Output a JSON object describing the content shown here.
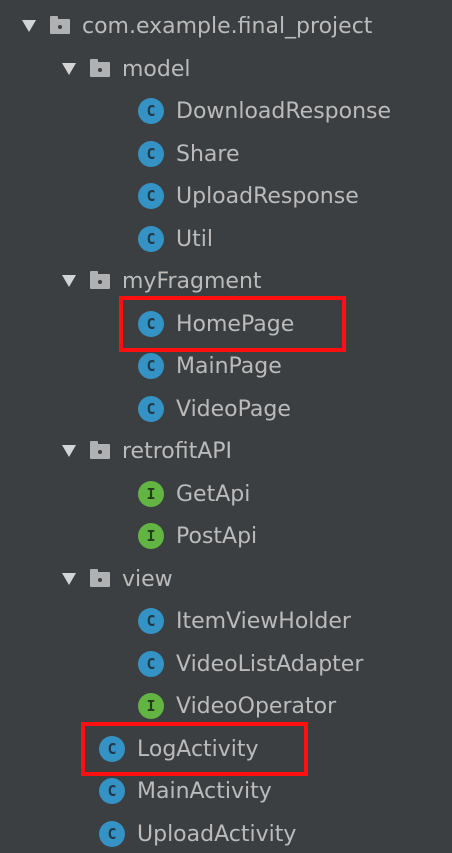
{
  "colors": {
    "background": "#3c3f41",
    "text": "#bbbbbb",
    "class_icon": "#3592c4",
    "interface_icon": "#62b543",
    "highlight": "#ff1010"
  },
  "tree": {
    "rows": [
      {
        "label": "com.example.final_project",
        "kind": "package",
        "expanded": true
      },
      {
        "label": "model",
        "kind": "package",
        "expanded": true
      },
      {
        "label": "DownloadResponse",
        "kind": "class",
        "badge": "C"
      },
      {
        "label": "Share",
        "kind": "class",
        "badge": "C"
      },
      {
        "label": "UploadResponse",
        "kind": "class",
        "badge": "C"
      },
      {
        "label": "Util",
        "kind": "class",
        "badge": "C"
      },
      {
        "label": "myFragment",
        "kind": "package",
        "expanded": true
      },
      {
        "label": "HomePage",
        "kind": "class",
        "badge": "C",
        "highlighted": true
      },
      {
        "label": "MainPage",
        "kind": "class",
        "badge": "C"
      },
      {
        "label": "VideoPage",
        "kind": "class",
        "badge": "C"
      },
      {
        "label": "retrofitAPI",
        "kind": "package",
        "expanded": true
      },
      {
        "label": "GetApi",
        "kind": "interface",
        "badge": "I"
      },
      {
        "label": "PostApi",
        "kind": "interface",
        "badge": "I"
      },
      {
        "label": "view",
        "kind": "package",
        "expanded": true
      },
      {
        "label": "ItemViewHolder",
        "kind": "class",
        "badge": "C"
      },
      {
        "label": "VideoListAdapter",
        "kind": "class",
        "badge": "C"
      },
      {
        "label": "VideoOperator",
        "kind": "interface",
        "badge": "I"
      },
      {
        "label": "LogActivity",
        "kind": "class",
        "badge": "C",
        "highlighted": true
      },
      {
        "label": "MainActivity",
        "kind": "class",
        "badge": "C"
      },
      {
        "label": "UploadActivity",
        "kind": "class",
        "badge": "C"
      }
    ]
  }
}
